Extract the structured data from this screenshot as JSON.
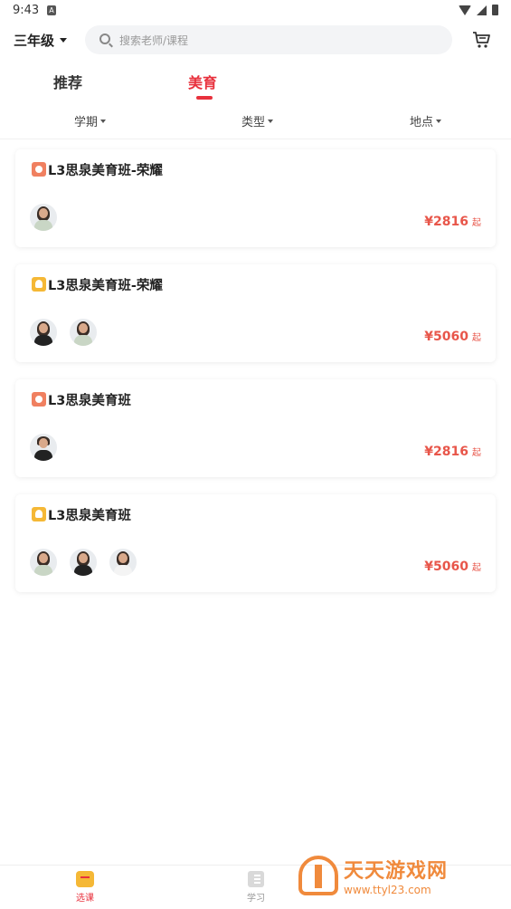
{
  "status_bar": {
    "time": "9:43",
    "notification": "A"
  },
  "header": {
    "grade": "三年级",
    "search_placeholder": "搜索老师/课程"
  },
  "tabs": [
    {
      "label": "推荐",
      "active": false
    },
    {
      "label": "美育",
      "active": true
    }
  ],
  "filters": [
    {
      "label": "学期"
    },
    {
      "label": "类型"
    },
    {
      "label": "地点"
    }
  ],
  "courses": [
    {
      "icon": "sun-icon",
      "title": "L3思泉美育班-荣耀",
      "teachers": [
        "light"
      ],
      "price": "¥2816",
      "suffix": "起"
    },
    {
      "icon": "leaf-icon",
      "title": "L3思泉美育班-荣耀",
      "teachers": [
        "dark",
        "light"
      ],
      "price": "¥5060",
      "suffix": "起"
    },
    {
      "icon": "sun-icon",
      "title": "L3思泉美育班",
      "teachers": [
        "dark"
      ],
      "price": "¥2816",
      "suffix": "起"
    },
    {
      "icon": "leaf-icon",
      "title": "L3思泉美育班",
      "teachers": [
        "light",
        "dark",
        "white"
      ],
      "price": "¥5060",
      "suffix": "起"
    }
  ],
  "bottom_nav": [
    {
      "label": "选课",
      "active": true
    },
    {
      "label": "学习",
      "active": false
    }
  ],
  "watermark": {
    "title": "天天游戏网",
    "url": "www.ttyl23.com"
  },
  "colors": {
    "accent": "#e8313d",
    "price": "#e8564a",
    "watermark": "#f08a3c"
  }
}
